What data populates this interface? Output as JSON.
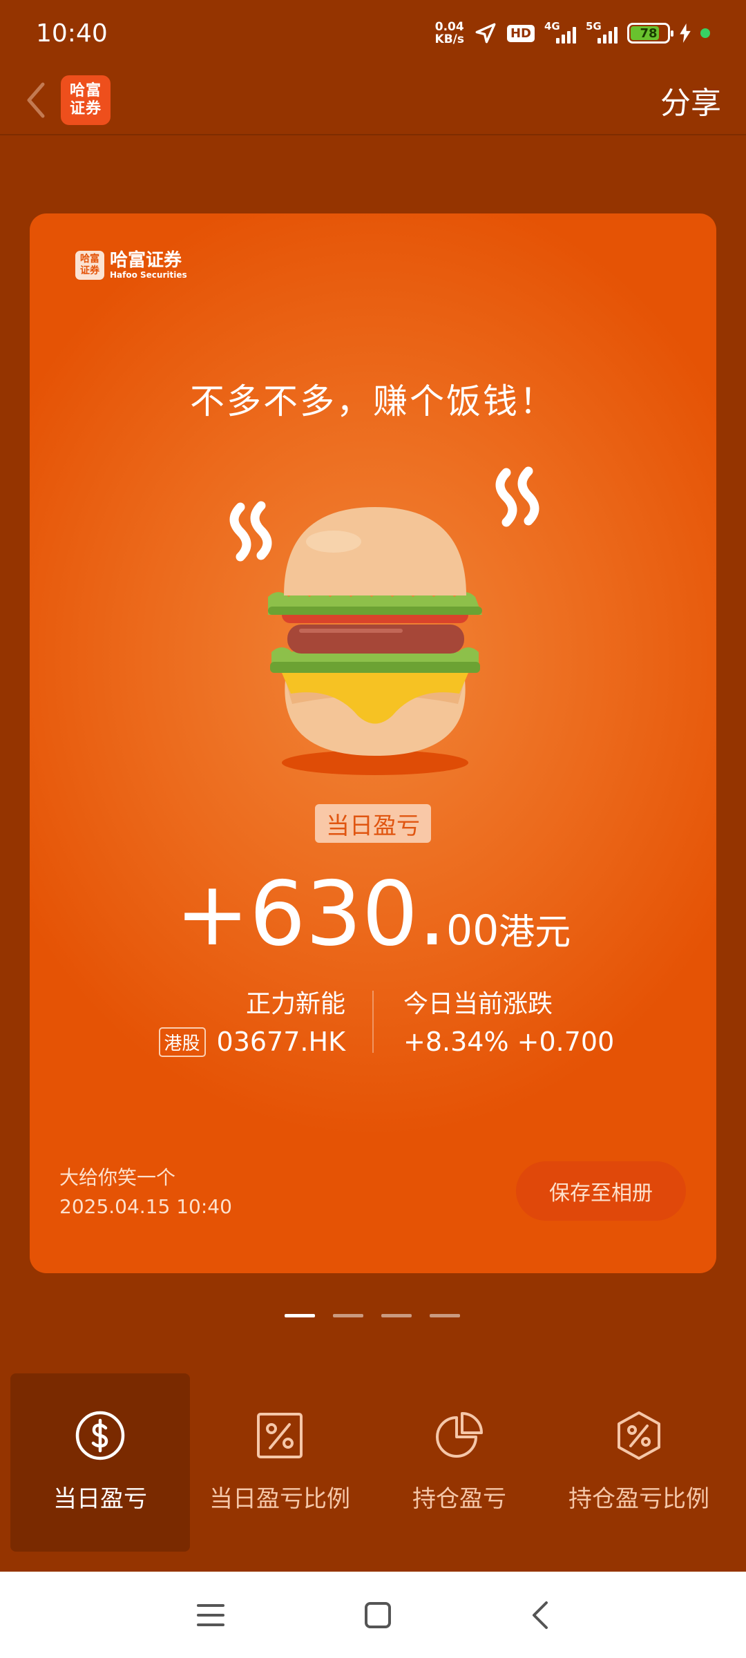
{
  "status_bar": {
    "time": "10:40",
    "net_speed_value": "0.04",
    "net_speed_unit": "KB/s",
    "hd_badge": "HD",
    "signal_1": "4G",
    "signal_2": "5G",
    "battery": "78"
  },
  "nav": {
    "logo_line1": "哈富",
    "logo_line2": "证券",
    "share_label": "分享"
  },
  "card": {
    "brand_badge_line1": "哈富",
    "brand_badge_line2": "证券",
    "brand_name": "哈富证券",
    "brand_name_en": "Hafoo Securities",
    "slogan": "不多不多，赚个饭钱！",
    "label": "当日盈亏",
    "amount_int": "+630.",
    "amount_dec": "00",
    "amount_currency": "港元",
    "stock_name": "正力新能",
    "market_tag": "港股",
    "stock_code": "03677.HK",
    "change_label": "今日当前涨跌",
    "change_value": "+8.34% +0.700",
    "footer_line1": "大给你笑一个",
    "footer_line2": "2025.04.15 10:40",
    "save_button": "保存至相册"
  },
  "pager": {
    "count": 4,
    "active_index": 0
  },
  "tabs": [
    {
      "label": "当日盈亏",
      "icon": "dollar-circle-icon",
      "active": true
    },
    {
      "label": "当日盈亏比例",
      "icon": "percent-square-icon",
      "active": false
    },
    {
      "label": "持仓盈亏",
      "icon": "pie-chart-icon",
      "active": false
    },
    {
      "label": "持仓盈亏比例",
      "icon": "percent-hexagon-icon",
      "active": false
    }
  ],
  "colors": {
    "background": "#953400",
    "card_orange": "#ec6a1c",
    "accent": "#ee4f1c",
    "active_tab": "#7a2a00"
  }
}
